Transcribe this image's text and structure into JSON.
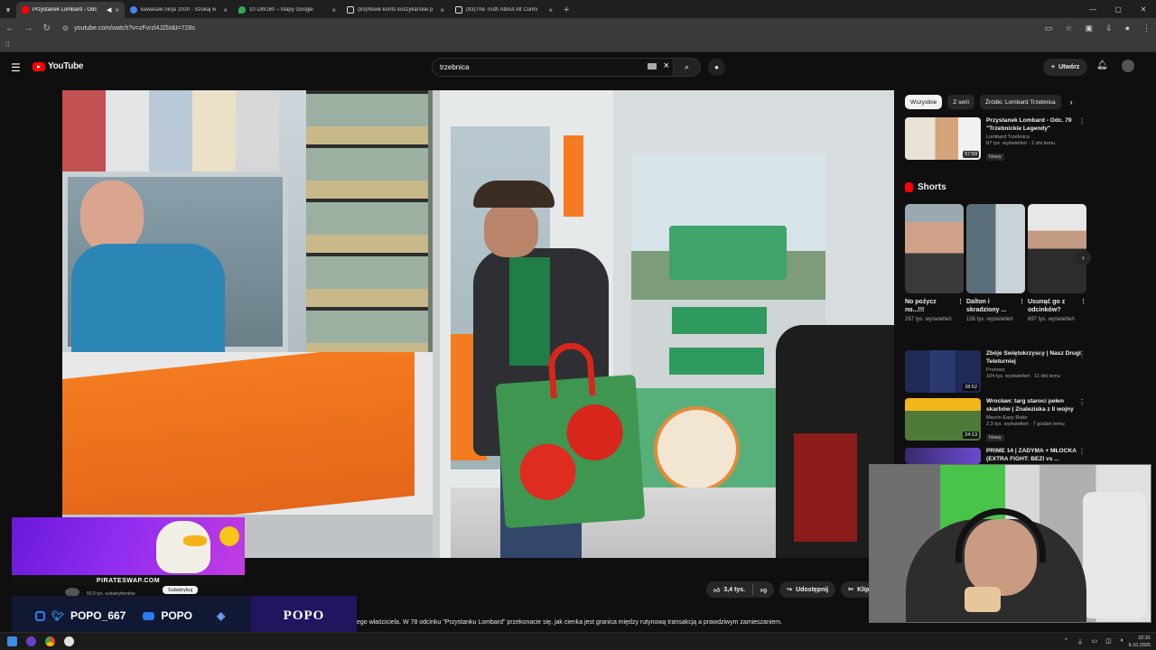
{
  "browser": {
    "tabs": [
      {
        "title": "Przystanek Lombard - Odc",
        "favicon_color": "#ff0000",
        "active": true
      },
      {
        "title": "kawasaki ninja 1000 - Szukaj w",
        "favicon_color": "#4285f4",
        "active": false
      },
      {
        "title": "10 DW160 – Mapy Google",
        "favicon_color": "#34a853",
        "active": false
      },
      {
        "title": "(83)Nowe konto koszykarskie p",
        "favicon_color": "#ffffff",
        "active": false
      },
      {
        "title": "(83)The Truth About Alt Cunni",
        "favicon_color": "#ffffff",
        "active": false
      }
    ],
    "url": "youtube.com/watch?v=zFvrzl4JZbI&t=728s"
  },
  "youtube": {
    "logo_text": "YouTube",
    "search_value": "trzebnica",
    "create_label": "Utwórz",
    "like_count": "3,4 tys.",
    "share_label": "Udostępnij",
    "clip_label": "Klip",
    "subscribe_label": "Subskrybuj",
    "subscribers": "50,9 tys. subskrybentów",
    "description": "ego właściciela. W 78 odcinku \"Przystanku Lombard\" przekonacie się, jak cienka jest granica między rutynową transakcją a prawdziwym zamieszaniem.",
    "chips": [
      "Wszystkie",
      "Z serii",
      "Źródło: Lombard Trzebnica"
    ],
    "rec_top": {
      "title": "Przystanek Lombard - Odc. 79 \"Trzebnickie Legendy\"",
      "channel": "Lombard Trzebnica",
      "meta": "87 tys. wyświetleń · 2 dni temu",
      "badge": "Nowy",
      "duration": "57:59"
    },
    "shorts_heading": "Shorts",
    "shorts": [
      {
        "title": "No pożycz no...!!!",
        "views": "267 tys. wyświetleń"
      },
      {
        "title": "Dalton i skradziony ...",
        "views": "156 tys. wyświetleń"
      },
      {
        "title": "Usunąć go z odcinków?",
        "views": "697 tys. wyświetleń"
      }
    ],
    "recommendations": [
      {
        "title": "Zbóje Świętokrzyscy | Nasz Drugi Teleturniej",
        "channel": "Pronosz",
        "meta": "104 tys. wyświetleń · 11 dni temu",
        "duration": "28:52",
        "badge": ""
      },
      {
        "title": "Wrocław: targ staroci pełen skarbów | Znaleziska z II wojny",
        "channel": "Marcin Easy Rider",
        "meta": "2,3 tys. wyświetleń · 7 godzin temu",
        "duration": "24:13",
        "badge": "Nowy"
      },
      {
        "title": "PRIME 14 | ZADYMA + MŁÓCKA (EXTRA FIGHT: BEZI vs ...",
        "channel": "",
        "meta": "",
        "duration": "",
        "badge": ""
      }
    ],
    "bottom_duration": "24:13"
  },
  "overlay": {
    "promo_url": "PIRATESWAP.COM",
    "handle": "POPO_667",
    "yt_name": "POPO",
    "brand": "POPO"
  },
  "taskbar": {
    "time": "22:31",
    "date": "9.10.2025"
  }
}
